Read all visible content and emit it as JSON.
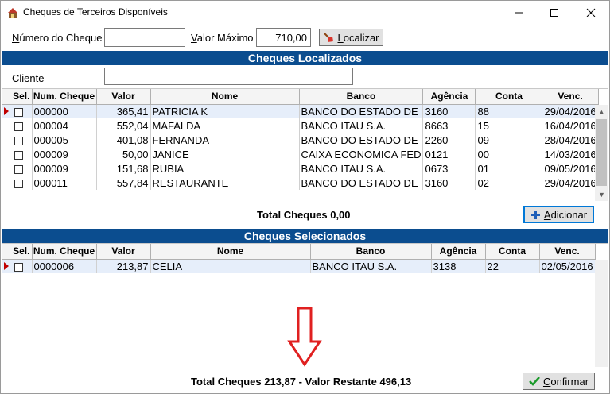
{
  "window": {
    "title": "Cheques de Terceiros Disponíveis"
  },
  "search": {
    "numero_label_u": "N",
    "numero_label_rest": "úmero do Cheque",
    "numero_value": "",
    "valor_label_u": "V",
    "valor_label_rest": "alor Máximo",
    "valor_value": "710,00",
    "localizar_u": "L",
    "localizar_rest": "ocalizar"
  },
  "localizados": {
    "title": "Cheques Localizados",
    "cliente_label_u": "C",
    "cliente_label_rest": "liente",
    "cliente_value": "",
    "columns": [
      "Sel.",
      "Num. Cheque",
      "Valor",
      "Nome",
      "Banco",
      "Agência",
      "Conta",
      "Venc."
    ],
    "rows": [
      [
        "000000",
        "365,41",
        "PATRICIA K",
        "BANCO DO ESTADO DE",
        "3160",
        "88",
        "29/04/2016"
      ],
      [
        "000004",
        "552,04",
        "MAFALDA",
        "BANCO ITAU S.A.",
        "8663",
        "15",
        "16/04/2016"
      ],
      [
        "000005",
        "401,08",
        "FERNANDA",
        "BANCO DO ESTADO DE",
        "2260",
        "09",
        "28/04/2016"
      ],
      [
        "000009",
        "50,00",
        "JANICE",
        "CAIXA ECONOMICA FED",
        "0121",
        "00",
        "14/03/2016"
      ],
      [
        "000009",
        "151,68",
        "RUBIA",
        "BANCO ITAU S.A.",
        "0673",
        "01",
        "09/05/2016"
      ],
      [
        "000011",
        "557,84",
        "RESTAURANTE",
        "BANCO DO ESTADO DE",
        "3160",
        "02",
        "29/04/2016"
      ]
    ],
    "total_label": "Total Cheques 0,00",
    "adicionar_u": "A",
    "adicionar_rest": "dicionar"
  },
  "selecionados": {
    "title": "Cheques Selecionados",
    "columns": [
      "Sel.",
      "Num. Cheque",
      "Valor",
      "Nome",
      "Banco",
      "Agência",
      "Conta",
      "Venc."
    ],
    "rows": [
      [
        "0000006",
        "213,87",
        "CELIA",
        "BANCO ITAU S.A.",
        "3138",
        "22",
        "02/05/2016"
      ]
    ],
    "total_label": "Total Cheques 213,87 - Valor Restante 496,13",
    "confirmar_u": "C",
    "confirmar_rest": "onfirmar"
  },
  "colors": {
    "section_bar": "#0b4d8f",
    "annotation_arrow": "#e02020",
    "row_selected": "#e6eefa"
  }
}
